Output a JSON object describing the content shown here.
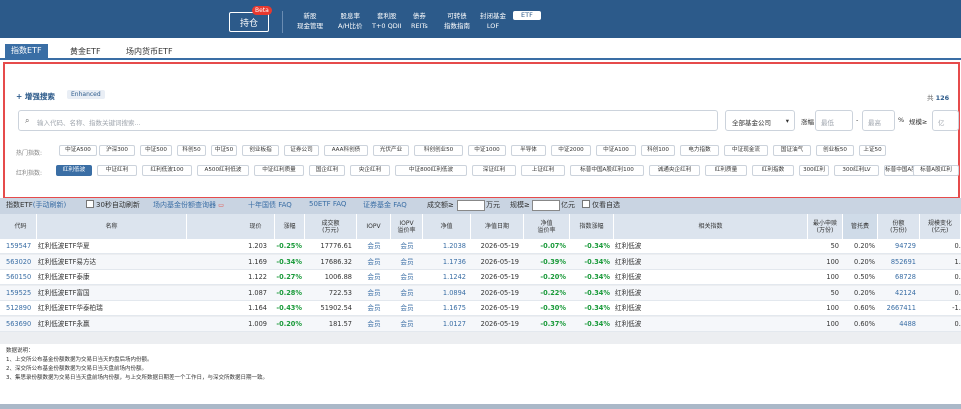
{
  "topnav": {
    "hold_label": "持仓",
    "beta": "Beta",
    "items": [
      {
        "line1": "新股",
        "line2": "现金管理"
      },
      {
        "line1": "股息率",
        "line2": "A/H比价"
      },
      {
        "line1": "套利股",
        "line2": "T+0 QDII"
      },
      {
        "line1": "债券",
        "line2": "REITs"
      },
      {
        "line1": "可转债",
        "line2": "指数指南"
      },
      {
        "line1": "封闭基金",
        "line2": "LOF"
      },
      {
        "line1": "ETF",
        "line2": ""
      }
    ]
  },
  "tabs": [
    "指数ETF",
    "黄金ETF",
    "场内货币ETF"
  ],
  "search": {
    "title": "增强搜索",
    "badge": "Enhanced",
    "total_prefix": "共",
    "total": "126",
    "placeholder": "输入代码、名称、指数关键词搜索...",
    "company_select": "全部基金公司",
    "pct_label": "涨幅",
    "min_ph": "最低",
    "dash": "-",
    "max_ph": "最高",
    "pct_unit": "%",
    "scale_label": "规模≥",
    "scale_unit": "亿"
  },
  "hot_indices": {
    "label": "热门指数:",
    "items": [
      "中证A500",
      "沪深300",
      "中证500",
      "科创50",
      "中证50",
      "创业板指",
      "证券公司",
      "AAA科创债",
      "光伏产业",
      "科创创业50",
      "中证1000",
      "半导体",
      "中证2000",
      "中证A100",
      "科创100",
      "电力指数",
      "中证现金流",
      "国证油气",
      "创业板50",
      "上证50"
    ]
  },
  "dividend_indices": {
    "label": "红利指数:",
    "items": [
      "红利低波",
      "中证红利",
      "红利低波100",
      "A500红利低波",
      "中证红利质量",
      "国企红利",
      "央企红利",
      "中证800红利低波",
      "深证红利",
      "上证红利",
      "标普中国A股红利100",
      "诚通央企红利",
      "红利质量",
      "红利指数",
      "300红利",
      "300红利LV",
      "标普中国A股大盘红利低波50",
      "标普A股红利"
    ]
  },
  "toolbar": {
    "title": "指数ETF",
    "manual": "(手动刷新)",
    "auto": "30秒自动刷新",
    "link1": "场内基金份额查询器",
    "link2": "十年国债 FAQ",
    "link3": "50ETF FAQ",
    "link4": "证券基金 FAQ",
    "turnover_label": "成交额≥",
    "turnover_unit": "万元",
    "scale_label": "规模≥",
    "scale_unit": "亿元",
    "fav": "仅看自选"
  },
  "table": {
    "headers": [
      "代码",
      "名称",
      "现价",
      "涨幅",
      "成交额\n(万元)",
      "IOPV",
      "IOPV\n溢价率",
      "净值",
      "净值日期",
      "净值\n溢价率",
      "指数涨幅",
      "相关指数",
      "最小申赎\n(万份)",
      "管托费",
      "份额\n(万份)",
      "规模变化\n(亿元)"
    ],
    "rows": [
      {
        "code": "159547",
        "name": "红利低波ETF华夏",
        "price": "1.203",
        "chg": "-0.25%",
        "amount": "17776.61",
        "iopv": "会员",
        "iopv_prem": "会员",
        "nav": "1.2038",
        "nav_date": "2026-05-19",
        "nav_prem": "-0.07%",
        "idx_chg": "-0.34%",
        "index": "红利低波",
        "min": "50",
        "fee": "0.20%",
        "shares": "94729",
        "scale_chg": "0.0"
      },
      {
        "code": "563020",
        "name": "红利低波ETF易方达",
        "price": "1.169",
        "chg": "-0.34%",
        "amount": "17686.32",
        "iopv": "会员",
        "iopv_prem": "会员",
        "nav": "1.1736",
        "nav_date": "2026-05-19",
        "nav_prem": "-0.39%",
        "idx_chg": "-0.34%",
        "index": "红利低波",
        "min": "100",
        "fee": "0.20%",
        "shares": "852691",
        "scale_chg": "1.2"
      },
      {
        "code": "560150",
        "name": "红利低波ETF泰康",
        "price": "1.122",
        "chg": "-0.27%",
        "amount": "1006.88",
        "iopv": "会员",
        "iopv_prem": "会员",
        "nav": "1.1242",
        "nav_date": "2026-05-19",
        "nav_prem": "-0.20%",
        "idx_chg": "-0.34%",
        "index": "红利低波",
        "min": "100",
        "fee": "0.50%",
        "shares": "68728",
        "scale_chg": "0.0"
      },
      {
        "code": "159525",
        "name": "红利低波ETF富国",
        "price": "1.087",
        "chg": "-0.28%",
        "amount": "722.53",
        "iopv": "会员",
        "iopv_prem": "会员",
        "nav": "1.0894",
        "nav_date": "2026-05-19",
        "nav_prem": "-0.22%",
        "idx_chg": "-0.34%",
        "index": "红利低波",
        "min": "50",
        "fee": "0.20%",
        "shares": "42124",
        "scale_chg": "0.0"
      },
      {
        "code": "512890",
        "name": "红利低波ETF华泰柏瑞",
        "price": "1.164",
        "chg": "-0.43%",
        "amount": "51902.54",
        "iopv": "会员",
        "iopv_prem": "会员",
        "nav": "1.1675",
        "nav_date": "2026-05-19",
        "nav_prem": "-0.30%",
        "idx_chg": "-0.34%",
        "index": "红利低波",
        "min": "100",
        "fee": "0.60%",
        "shares": "2667411",
        "scale_chg": "-1.0"
      },
      {
        "code": "563690",
        "name": "红利低波ETF永赢",
        "price": "1.009",
        "chg": "-0.20%",
        "amount": "181.57",
        "iopv": "会员",
        "iopv_prem": "会员",
        "nav": "1.0127",
        "nav_date": "2026-05-19",
        "nav_prem": "-0.37%",
        "idx_chg": "-0.34%",
        "index": "红利低波",
        "min": "100",
        "fee": "0.60%",
        "shares": "4488",
        "scale_chg": "0.0"
      }
    ]
  },
  "notes": {
    "title": "数据说明：",
    "lines": [
      "1、上交所公布基金份额数据为交易日当天的盘后场内份额。",
      "2、深交所公布基金份额数据为交易日当天盘前场内份额。",
      "3、集思录份额数据为交易日当天盘前场内份额，与上交所数据日期差一个工作日，与深交所数据日期一致。"
    ]
  },
  "colors": {
    "nav": "#2c5a8a",
    "accent": "#3a6ea5",
    "highlight_border": "#e64b4b",
    "down": "#1a9a3a"
  }
}
